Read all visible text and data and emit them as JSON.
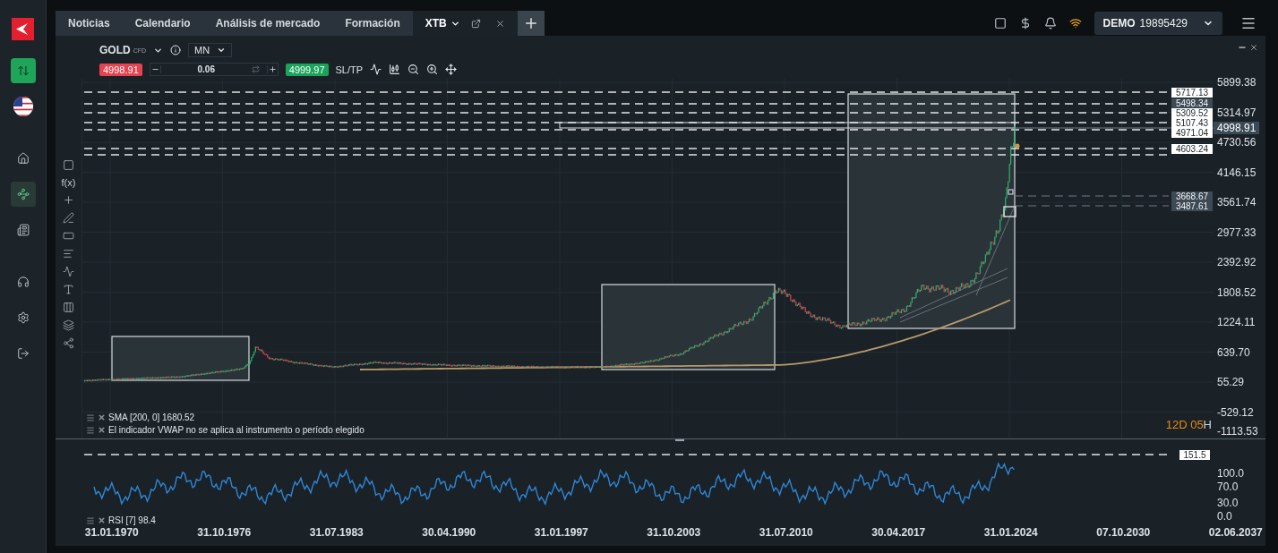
{
  "sidebar": {
    "items": [
      {
        "kind": "trade",
        "selected": true
      },
      {
        "kind": "flag",
        "selected": false
      },
      {
        "kind": "home",
        "selected": false
      },
      {
        "kind": "chart",
        "selected": true
      },
      {
        "kind": "news",
        "selected": false
      },
      {
        "kind": "support",
        "selected": false
      },
      {
        "kind": "settings",
        "selected": false
      },
      {
        "kind": "logout",
        "selected": false
      }
    ]
  },
  "tabs": [
    {
      "label": "Noticias",
      "selected": false
    },
    {
      "label": "Calendario",
      "selected": false
    },
    {
      "label": "Análisis de mercado",
      "selected": false
    },
    {
      "label": "Formación",
      "selected": false
    },
    {
      "label": "XTB",
      "selected": true
    }
  ],
  "account": {
    "mode": "DEMO",
    "number": "19895429"
  },
  "instrument": {
    "symbol": "GOLD",
    "type": "CFD",
    "timeframe": "MN"
  },
  "trade_bar": {
    "sell": "4998.91",
    "volume": "0.06",
    "buy": "4999.97",
    "sltp": "SL/TP"
  },
  "tools": [
    {
      "kind": "layout"
    },
    {
      "kind": "text",
      "label": "f(x)"
    },
    {
      "kind": "crosshair"
    },
    {
      "kind": "line"
    },
    {
      "kind": "rectangle"
    },
    {
      "kind": "fibonacci"
    },
    {
      "kind": "fan"
    },
    {
      "kind": "type"
    },
    {
      "kind": "candles"
    },
    {
      "kind": "layers"
    },
    {
      "kind": "share"
    }
  ],
  "price_axis": [
    "5899.38",
    "5314.97",
    "4730.56",
    "4146.15",
    "3561.74",
    "2977.33",
    "2392.92",
    "1808.52",
    "1224.11",
    "639.70",
    "55.29",
    "-529.12",
    "-1113.53"
  ],
  "current_price": "4998.91",
  "levels": [
    {
      "text": "5717.13",
      "kind": "line"
    },
    {
      "text": "5498.34",
      "kind": "order"
    },
    {
      "text": "5309.52",
      "kind": "line"
    },
    {
      "text": "5107.43",
      "kind": "line"
    },
    {
      "text": "4971.04",
      "kind": "line"
    },
    {
      "text": "4603.24",
      "kind": "line"
    },
    {
      "text": "3668.67",
      "kind": "order"
    },
    {
      "text": "3487.61",
      "kind": "order"
    }
  ],
  "legends": [
    "SMA [200, 0] 1680.52",
    "El indicador VWAP no se aplica al instrumento o período elegido"
  ],
  "countdown": {
    "value": "12D 05",
    "suffix": "H"
  },
  "rsi": {
    "legend": "RSI [7] 98.4",
    "level": "151.5",
    "axis": [
      "100.0",
      "70.0",
      "30.0",
      "0.0"
    ]
  },
  "dates": [
    "31.01.1970",
    "31.10.1976",
    "31.07.1983",
    "30.04.1990",
    "31.01.1997",
    "31.10.2003",
    "31.07.2010",
    "30.04.2017",
    "31.01.2024",
    "07.10.2030",
    "02.06.2037"
  ]
}
